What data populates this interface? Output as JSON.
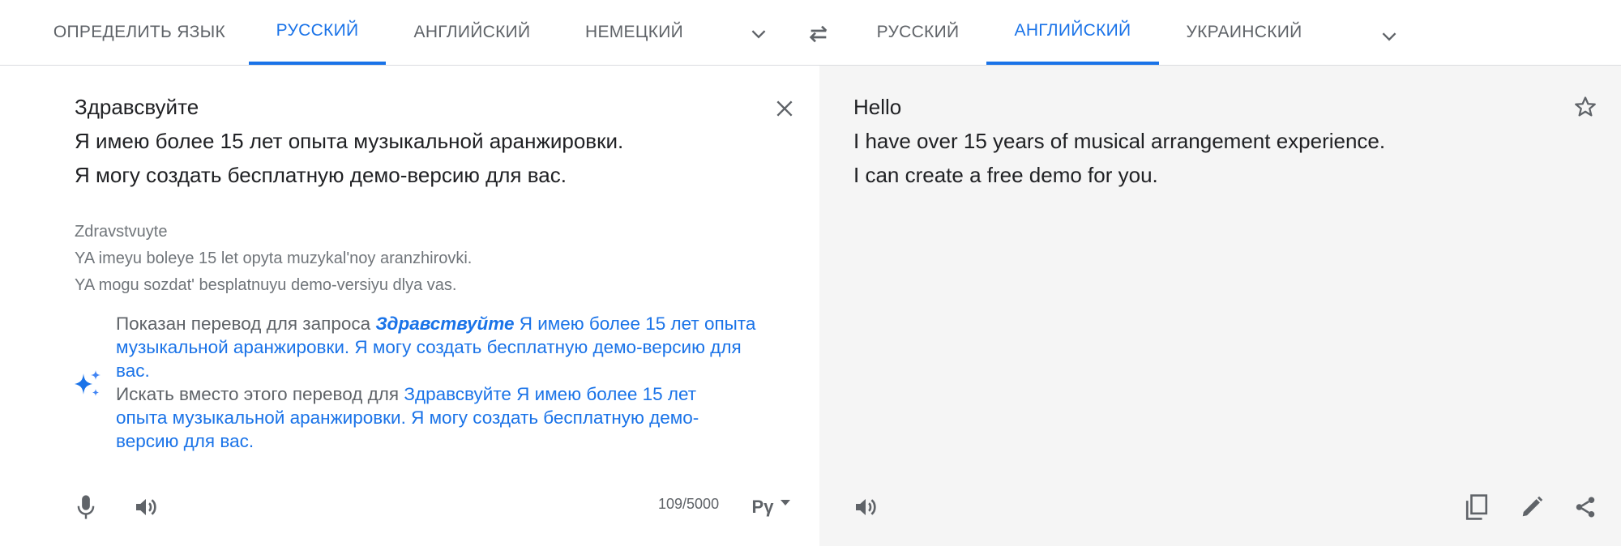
{
  "source_tabs": [
    "ОПРЕДЕЛИТЬ ЯЗЫК",
    "РУССКИЙ",
    "АНГЛИЙСКИЙ",
    "НЕМЕЦКИЙ"
  ],
  "target_tabs": [
    "РУССКИЙ",
    "АНГЛИЙСКИЙ",
    "УКРАИНСКИЙ"
  ],
  "source": {
    "lines": [
      "Здравсвуйте",
      "Я имею более 15 лет опыта музыкальной аранжировки.",
      "Я могу создать бесплатную демо-версию для вас."
    ],
    "transliteration": [
      "Zdravstvuyte",
      "YA imeyu boleye 15 let opyta muzykal'noy aranzhirovki.",
      "YA mogu sozdat' besplatnuyu demo-versiyu dlya vas."
    ],
    "char_count": "109/5000",
    "keyboard_label": "Рγ"
  },
  "suggestion": {
    "showing_prefix": "Показан перевод для запроса ",
    "corrected_word": "Здравствуйте",
    "showing_line1_rest": " Я имею более 15 лет опыта",
    "showing_line2": "музыкальной аранжировки. Я могу создать бесплатную демо-версию для",
    "showing_line3": "вас.",
    "instead_prefix": "Искать вместо этого перевод для ",
    "instead_line1_rest": "Здравсвуйте Я имею более 15 лет",
    "instead_line2": "опыта музыкальной аранжировки. Я могу создать бесплатную демо-",
    "instead_line3": "версию для вас."
  },
  "translation": {
    "lines": [
      "Hello",
      "I have over 15 years of musical arrangement experience.",
      "I can create a free demo for you."
    ]
  },
  "colors": {
    "accent": "#1a73e8",
    "right_panel_bg": "#f5f5f5"
  }
}
